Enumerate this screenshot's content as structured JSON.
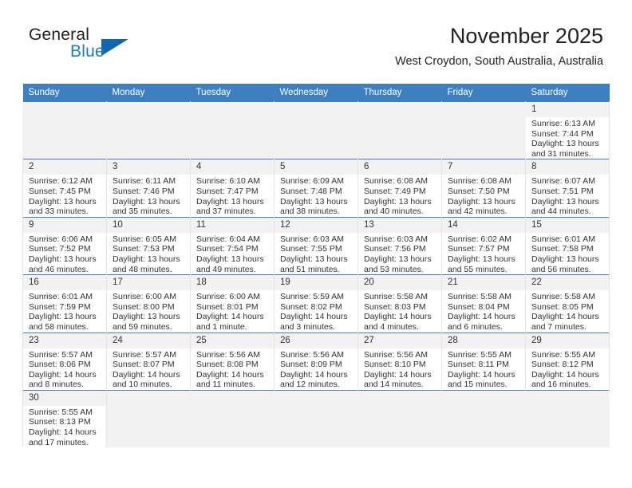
{
  "brand": {
    "name_top": "General",
    "name_bottom": "Blue",
    "accent_color": "#1167ae",
    "text_color": "#1f7ac4"
  },
  "header": {
    "title": "November 2025",
    "subtitle": "West Croydon, South Australia, Australia"
  },
  "theme": {
    "header_row_bg": "#3d7fc1",
    "header_row_text": "#ffffff",
    "daynum_bg": "#f2f2f2",
    "empty_cell_bg": "#f2f2f2",
    "body_text": "#333333"
  },
  "weekdays": [
    "Sunday",
    "Monday",
    "Tuesday",
    "Wednesday",
    "Thursday",
    "Friday",
    "Saturday"
  ],
  "weeks": [
    [
      {
        "day": "",
        "lines": []
      },
      {
        "day": "",
        "lines": []
      },
      {
        "day": "",
        "lines": []
      },
      {
        "day": "",
        "lines": []
      },
      {
        "day": "",
        "lines": []
      },
      {
        "day": "",
        "lines": []
      },
      {
        "day": "1",
        "lines": [
          "Sunrise: 6:13 AM",
          "Sunset: 7:44 PM",
          "Daylight: 13 hours",
          "and 31 minutes."
        ]
      }
    ],
    [
      {
        "day": "2",
        "lines": [
          "Sunrise: 6:12 AM",
          "Sunset: 7:45 PM",
          "Daylight: 13 hours",
          "and 33 minutes."
        ]
      },
      {
        "day": "3",
        "lines": [
          "Sunrise: 6:11 AM",
          "Sunset: 7:46 PM",
          "Daylight: 13 hours",
          "and 35 minutes."
        ]
      },
      {
        "day": "4",
        "lines": [
          "Sunrise: 6:10 AM",
          "Sunset: 7:47 PM",
          "Daylight: 13 hours",
          "and 37 minutes."
        ]
      },
      {
        "day": "5",
        "lines": [
          "Sunrise: 6:09 AM",
          "Sunset: 7:48 PM",
          "Daylight: 13 hours",
          "and 38 minutes."
        ]
      },
      {
        "day": "6",
        "lines": [
          "Sunrise: 6:08 AM",
          "Sunset: 7:49 PM",
          "Daylight: 13 hours",
          "and 40 minutes."
        ]
      },
      {
        "day": "7",
        "lines": [
          "Sunrise: 6:08 AM",
          "Sunset: 7:50 PM",
          "Daylight: 13 hours",
          "and 42 minutes."
        ]
      },
      {
        "day": "8",
        "lines": [
          "Sunrise: 6:07 AM",
          "Sunset: 7:51 PM",
          "Daylight: 13 hours",
          "and 44 minutes."
        ]
      }
    ],
    [
      {
        "day": "9",
        "lines": [
          "Sunrise: 6:06 AM",
          "Sunset: 7:52 PM",
          "Daylight: 13 hours",
          "and 46 minutes."
        ]
      },
      {
        "day": "10",
        "lines": [
          "Sunrise: 6:05 AM",
          "Sunset: 7:53 PM",
          "Daylight: 13 hours",
          "and 48 minutes."
        ]
      },
      {
        "day": "11",
        "lines": [
          "Sunrise: 6:04 AM",
          "Sunset: 7:54 PM",
          "Daylight: 13 hours",
          "and 49 minutes."
        ]
      },
      {
        "day": "12",
        "lines": [
          "Sunrise: 6:03 AM",
          "Sunset: 7:55 PM",
          "Daylight: 13 hours",
          "and 51 minutes."
        ]
      },
      {
        "day": "13",
        "lines": [
          "Sunrise: 6:03 AM",
          "Sunset: 7:56 PM",
          "Daylight: 13 hours",
          "and 53 minutes."
        ]
      },
      {
        "day": "14",
        "lines": [
          "Sunrise: 6:02 AM",
          "Sunset: 7:57 PM",
          "Daylight: 13 hours",
          "and 55 minutes."
        ]
      },
      {
        "day": "15",
        "lines": [
          "Sunrise: 6:01 AM",
          "Sunset: 7:58 PM",
          "Daylight: 13 hours",
          "and 56 minutes."
        ]
      }
    ],
    [
      {
        "day": "16",
        "lines": [
          "Sunrise: 6:01 AM",
          "Sunset: 7:59 PM",
          "Daylight: 13 hours",
          "and 58 minutes."
        ]
      },
      {
        "day": "17",
        "lines": [
          "Sunrise: 6:00 AM",
          "Sunset: 8:00 PM",
          "Daylight: 13 hours",
          "and 59 minutes."
        ]
      },
      {
        "day": "18",
        "lines": [
          "Sunrise: 6:00 AM",
          "Sunset: 8:01 PM",
          "Daylight: 14 hours",
          "and 1 minute."
        ]
      },
      {
        "day": "19",
        "lines": [
          "Sunrise: 5:59 AM",
          "Sunset: 8:02 PM",
          "Daylight: 14 hours",
          "and 3 minutes."
        ]
      },
      {
        "day": "20",
        "lines": [
          "Sunrise: 5:58 AM",
          "Sunset: 8:03 PM",
          "Daylight: 14 hours",
          "and 4 minutes."
        ]
      },
      {
        "day": "21",
        "lines": [
          "Sunrise: 5:58 AM",
          "Sunset: 8:04 PM",
          "Daylight: 14 hours",
          "and 6 minutes."
        ]
      },
      {
        "day": "22",
        "lines": [
          "Sunrise: 5:58 AM",
          "Sunset: 8:05 PM",
          "Daylight: 14 hours",
          "and 7 minutes."
        ]
      }
    ],
    [
      {
        "day": "23",
        "lines": [
          "Sunrise: 5:57 AM",
          "Sunset: 8:06 PM",
          "Daylight: 14 hours",
          "and 8 minutes."
        ]
      },
      {
        "day": "24",
        "lines": [
          "Sunrise: 5:57 AM",
          "Sunset: 8:07 PM",
          "Daylight: 14 hours",
          "and 10 minutes."
        ]
      },
      {
        "day": "25",
        "lines": [
          "Sunrise: 5:56 AM",
          "Sunset: 8:08 PM",
          "Daylight: 14 hours",
          "and 11 minutes."
        ]
      },
      {
        "day": "26",
        "lines": [
          "Sunrise: 5:56 AM",
          "Sunset: 8:09 PM",
          "Daylight: 14 hours",
          "and 12 minutes."
        ]
      },
      {
        "day": "27",
        "lines": [
          "Sunrise: 5:56 AM",
          "Sunset: 8:10 PM",
          "Daylight: 14 hours",
          "and 14 minutes."
        ]
      },
      {
        "day": "28",
        "lines": [
          "Sunrise: 5:55 AM",
          "Sunset: 8:11 PM",
          "Daylight: 14 hours",
          "and 15 minutes."
        ]
      },
      {
        "day": "29",
        "lines": [
          "Sunrise: 5:55 AM",
          "Sunset: 8:12 PM",
          "Daylight: 14 hours",
          "and 16 minutes."
        ]
      }
    ],
    [
      {
        "day": "30",
        "lines": [
          "Sunrise: 5:55 AM",
          "Sunset: 8:13 PM",
          "Daylight: 14 hours",
          "and 17 minutes."
        ]
      },
      {
        "day": "",
        "lines": []
      },
      {
        "day": "",
        "lines": []
      },
      {
        "day": "",
        "lines": []
      },
      {
        "day": "",
        "lines": []
      },
      {
        "day": "",
        "lines": []
      },
      {
        "day": "",
        "lines": []
      }
    ]
  ]
}
